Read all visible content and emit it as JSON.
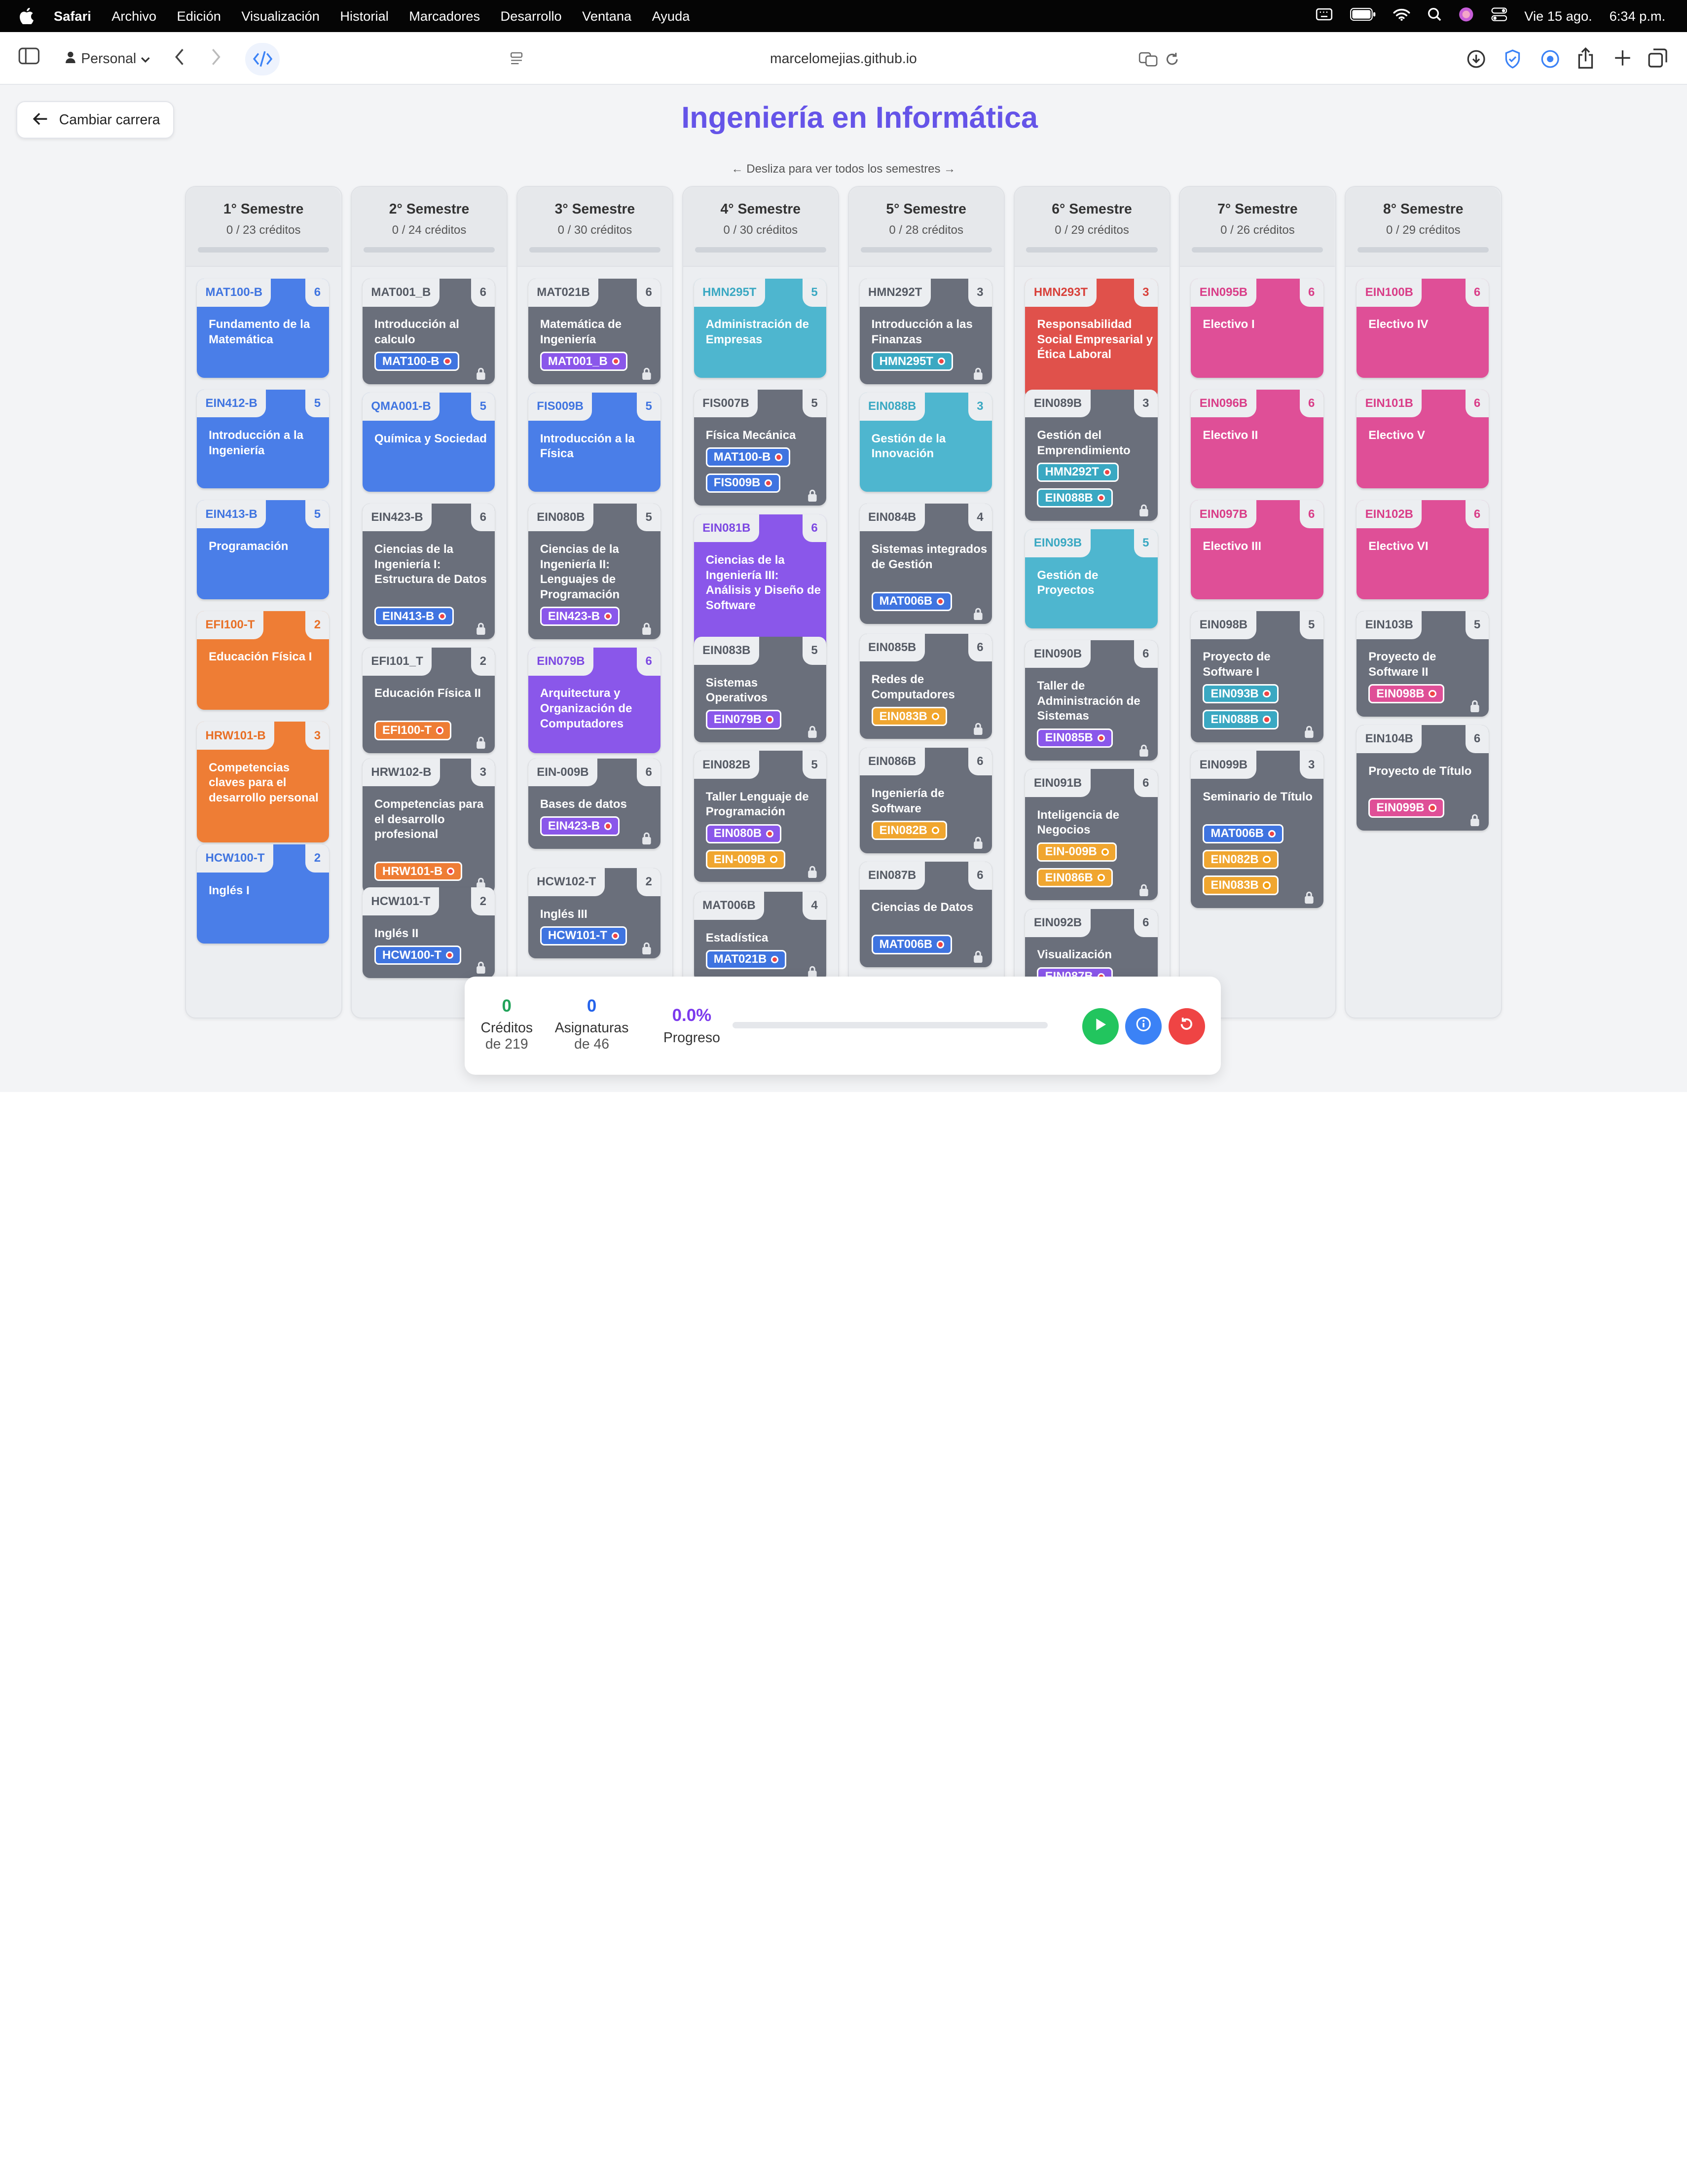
{
  "menubar": {
    "app": "Safari",
    "items": [
      "Archivo",
      "Edición",
      "Visualización",
      "Historial",
      "Marcadores",
      "Desarrollo",
      "Ventana",
      "Ayuda"
    ],
    "date": "Vie 15 ago.",
    "time": "6:34 p.m."
  },
  "browser": {
    "profile": "Personal",
    "url": "marcelomejias.github.io"
  },
  "page": {
    "back_label": "Cambiar carrera",
    "title": "Ingeniería en Informática",
    "hint": "← Desliza para ver todos los semestres →"
  },
  "semesters": [
    {
      "title": "1° Semestre",
      "credits": "0 / 23 créditos",
      "courses": [
        {
          "code": "MAT100-B",
          "cr": "6",
          "name": "Fundamento de la Matemática",
          "color": "blue",
          "reqs": [],
          "locked": false
        },
        {
          "code": "EIN412-B",
          "cr": "5",
          "name": "Introducción a la Ingeniería",
          "color": "blue",
          "reqs": [],
          "locked": false
        },
        {
          "code": "EIN413-B",
          "cr": "5",
          "name": "Programación",
          "color": "blue",
          "reqs": [],
          "locked": false
        },
        {
          "code": "EFI100-T",
          "cr": "2",
          "name": "Educación Física I",
          "color": "orange",
          "reqs": [],
          "locked": false
        },
        {
          "code": "HRW101-B",
          "cr": "3",
          "name": "Competencias claves para el desarrollo personal",
          "color": "orange",
          "reqs": [],
          "locked": false
        },
        {
          "code": "HCW100-T",
          "cr": "2",
          "name": "Inglés I",
          "color": "blue",
          "reqs": [],
          "locked": false
        }
      ]
    },
    {
      "title": "2° Semestre",
      "credits": "0 / 24 créditos",
      "courses": [
        {
          "code": "MAT001_B",
          "cr": "6",
          "name": "Introducción al calculo",
          "color": "gray",
          "reqs": [
            {
              "code": "MAT100-B",
              "c": "blue"
            }
          ],
          "locked": true
        },
        {
          "code": "QMA001-B",
          "cr": "5",
          "name": "Química y Sociedad",
          "color": "blue",
          "reqs": [],
          "locked": false
        },
        {
          "code": "EIN423-B",
          "cr": "6",
          "name": "Ciencias de la Ingeniería I: Estructura de Datos",
          "color": "gray",
          "reqs": [
            {
              "code": "EIN413-B",
              "c": "blue"
            }
          ],
          "locked": true
        },
        {
          "code": "EFI101_T",
          "cr": "2",
          "name": "Educación Física II",
          "color": "gray",
          "reqs": [
            {
              "code": "EFI100-T",
              "c": "orange"
            }
          ],
          "locked": true
        },
        {
          "code": "HRW102-B",
          "cr": "3",
          "name": "Competencias para el desarrollo profesional",
          "color": "gray",
          "reqs": [
            {
              "code": "HRW101-B",
              "c": "orange"
            }
          ],
          "locked": true
        },
        {
          "code": "HCW101-T",
          "cr": "2",
          "name": "Inglés II",
          "color": "gray",
          "reqs": [
            {
              "code": "HCW100-T",
              "c": "blue"
            }
          ],
          "locked": true
        }
      ]
    },
    {
      "title": "3° Semestre",
      "credits": "0 / 30 créditos",
      "courses": [
        {
          "code": "MAT021B",
          "cr": "6",
          "name": "Matemática de Ingeniería",
          "color": "gray",
          "reqs": [
            {
              "code": "MAT001_B",
              "c": "purple"
            }
          ],
          "locked": true
        },
        {
          "code": "FIS009B",
          "cr": "5",
          "name": "Introducción a la Física",
          "color": "blue",
          "reqs": [],
          "locked": false
        },
        {
          "code": "EIN080B",
          "cr": "5",
          "name": "Ciencias de la Ingeniería II: Lenguajes de Programación",
          "color": "gray",
          "reqs": [
            {
              "code": "EIN423-B",
              "c": "purple"
            }
          ],
          "locked": true
        },
        {
          "code": "EIN079B",
          "cr": "6",
          "name": "Arquitectura y Organización de Computadores",
          "color": "purple",
          "reqs": [],
          "locked": false
        },
        {
          "code": "EIN-009B",
          "cr": "6",
          "name": "Bases de datos",
          "color": "gray",
          "reqs": [
            {
              "code": "EIN423-B",
              "c": "purple"
            }
          ],
          "locked": true
        },
        {
          "code": "HCW102-T",
          "cr": "2",
          "name": "Inglés III",
          "color": "gray",
          "reqs": [
            {
              "code": "HCW101-T",
              "c": "blue"
            }
          ],
          "locked": true
        }
      ]
    },
    {
      "title": "4° Semestre",
      "credits": "0 / 30 créditos",
      "courses": [
        {
          "code": "HMN295T",
          "cr": "5",
          "name": "Administración de Empresas",
          "color": "cyan",
          "reqs": [],
          "locked": false
        },
        {
          "code": "FIS007B",
          "cr": "5",
          "name": "Física Mecánica",
          "color": "gray",
          "reqs": [
            {
              "code": "MAT100-B",
              "c": "blue"
            },
            {
              "code": "FIS009B",
              "c": "blue"
            }
          ],
          "locked": true
        },
        {
          "code": "EIN081B",
          "cr": "6",
          "name": "Ciencias de la Ingeniería III: Análisis y Diseño de Software",
          "color": "purple",
          "reqs": [],
          "locked": false
        },
        {
          "code": "EIN083B",
          "cr": "5",
          "name": "Sistemas Operativos",
          "color": "gray",
          "reqs": [
            {
              "code": "EIN079B",
              "c": "purple"
            }
          ],
          "locked": true
        },
        {
          "code": "EIN082B",
          "cr": "5",
          "name": "Taller Lenguaje de Programación",
          "color": "gray",
          "reqs": [
            {
              "code": "EIN080B",
              "c": "purple"
            },
            {
              "code": "EIN-009B",
              "c": "amber"
            }
          ],
          "locked": true
        },
        {
          "code": "MAT006B",
          "cr": "4",
          "name": "Estadística",
          "color": "gray",
          "reqs": [
            {
              "code": "MAT021B",
              "c": "blue"
            }
          ],
          "locked": true
        }
      ]
    },
    {
      "title": "5° Semestre",
      "credits": "0 / 28 créditos",
      "courses": [
        {
          "code": "HMN292T",
          "cr": "3",
          "name": "Introducción a las Finanzas",
          "color": "gray",
          "reqs": [
            {
              "code": "HMN295T",
              "c": "cyan"
            }
          ],
          "locked": true
        },
        {
          "code": "EIN088B",
          "cr": "3",
          "name": "Gestión de la Innovación",
          "color": "cyan",
          "reqs": [],
          "locked": false
        },
        {
          "code": "EIN084B",
          "cr": "4",
          "name": "Sistemas integrados de Gestión",
          "color": "gray",
          "reqs": [
            {
              "code": "MAT006B",
              "c": "blue"
            }
          ],
          "locked": true
        },
        {
          "code": "EIN085B",
          "cr": "6",
          "name": "Redes de Computadores",
          "color": "gray",
          "reqs": [
            {
              "code": "EIN083B",
              "c": "amber"
            }
          ],
          "locked": true
        },
        {
          "code": "EIN086B",
          "cr": "6",
          "name": "Ingeniería de Software",
          "color": "gray",
          "reqs": [
            {
              "code": "EIN082B",
              "c": "amber"
            }
          ],
          "locked": true
        },
        {
          "code": "EIN087B",
          "cr": "6",
          "name": "Ciencias de Datos",
          "color": "gray",
          "reqs": [
            {
              "code": "MAT006B",
              "c": "blue"
            }
          ],
          "locked": true
        }
      ]
    },
    {
      "title": "6° Semestre",
      "credits": "0 / 29 créditos",
      "courses": [
        {
          "code": "HMN293T",
          "cr": "3",
          "name": "Responsabilidad Social Empresarial y Ética Laboral",
          "color": "red",
          "reqs": [],
          "locked": false
        },
        {
          "code": "EIN089B",
          "cr": "3",
          "name": "Gestión del Emprendimiento",
          "color": "gray",
          "reqs": [
            {
              "code": "HMN292T",
              "c": "cyan"
            },
            {
              "code": "EIN088B",
              "c": "cyan"
            }
          ],
          "locked": true
        },
        {
          "code": "EIN093B",
          "cr": "5",
          "name": "Gestión de Proyectos",
          "color": "cyan",
          "reqs": [],
          "locked": false
        },
        {
          "code": "EIN090B",
          "cr": "6",
          "name": "Taller de Administración de Sistemas",
          "color": "gray",
          "reqs": [
            {
              "code": "EIN085B",
              "c": "purple"
            }
          ],
          "locked": true
        },
        {
          "code": "EIN091B",
          "cr": "6",
          "name": "Inteligencia de Negocios",
          "color": "gray",
          "reqs": [
            {
              "code": "EIN-009B",
              "c": "amber"
            },
            {
              "code": "EIN086B",
              "c": "amber"
            }
          ],
          "locked": true
        },
        {
          "code": "EIN092B",
          "cr": "6",
          "name": "Visualización",
          "color": "gray",
          "reqs": [
            {
              "code": "EIN087B",
              "c": "purple"
            }
          ],
          "locked": true
        }
      ]
    },
    {
      "title": "7° Semestre",
      "credits": "0 / 26 créditos",
      "courses": [
        {
          "code": "EIN095B",
          "cr": "6",
          "name": "Electivo I",
          "color": "pink",
          "reqs": [],
          "locked": false
        },
        {
          "code": "EIN096B",
          "cr": "6",
          "name": "Electivo II",
          "color": "pink",
          "reqs": [],
          "locked": false
        },
        {
          "code": "EIN097B",
          "cr": "6",
          "name": "Electivo III",
          "color": "pink",
          "reqs": [],
          "locked": false
        },
        {
          "code": "EIN098B",
          "cr": "5",
          "name": "Proyecto de Software I",
          "color": "gray",
          "reqs": [
            {
              "code": "EIN093B",
              "c": "cyan"
            },
            {
              "code": "EIN088B",
              "c": "cyan"
            }
          ],
          "locked": true
        },
        {
          "code": "EIN099B",
          "cr": "3",
          "name": "Seminario de Título",
          "color": "gray",
          "reqs": [
            {
              "code": "MAT006B",
              "c": "blue"
            },
            {
              "code": "EIN082B",
              "c": "amber"
            },
            {
              "code": "EIN083B",
              "c": "amber"
            }
          ],
          "locked": true
        }
      ]
    },
    {
      "title": "8° Semestre",
      "credits": "0 / 29 créditos",
      "courses": [
        {
          "code": "EIN100B",
          "cr": "6",
          "name": "Electivo IV",
          "color": "pink",
          "reqs": [],
          "locked": false
        },
        {
          "code": "EIN101B",
          "cr": "6",
          "name": "Electivo V",
          "color": "pink",
          "reqs": [],
          "locked": false
        },
        {
          "code": "EIN102B",
          "cr": "6",
          "name": "Electivo VI",
          "color": "pink",
          "reqs": [],
          "locked": false
        },
        {
          "code": "EIN103B",
          "cr": "5",
          "name": "Proyecto de Software II",
          "color": "gray",
          "reqs": [
            {
              "code": "EIN098B",
              "c": "pink"
            }
          ],
          "locked": true
        },
        {
          "code": "EIN104B",
          "cr": "6",
          "name": "Proyecto de Título",
          "color": "gray",
          "reqs": [
            {
              "code": "EIN099B",
              "c": "pink"
            }
          ],
          "locked": true
        }
      ]
    }
  ],
  "stats": {
    "credits_value": "0",
    "credits_label": "Créditos",
    "credits_total": "de 219",
    "subjects_value": "0",
    "subjects_label": "Asignaturas",
    "subjects_total": "de 46",
    "progress_value": "0.0%",
    "progress_label": "Progreso",
    "progress_fraction": 0
  },
  "colors": {
    "accent": "#6554e8",
    "blue": "#4a7ee8",
    "gray": "#6a6f7b",
    "orange": "#ee7d35",
    "cyan": "#4eb6cf",
    "purple": "#8a57ea",
    "red": "#e0514b",
    "pink": "#df4f97",
    "play": "#22c55e",
    "info": "#3b82f6",
    "reset": "#ef4444"
  }
}
